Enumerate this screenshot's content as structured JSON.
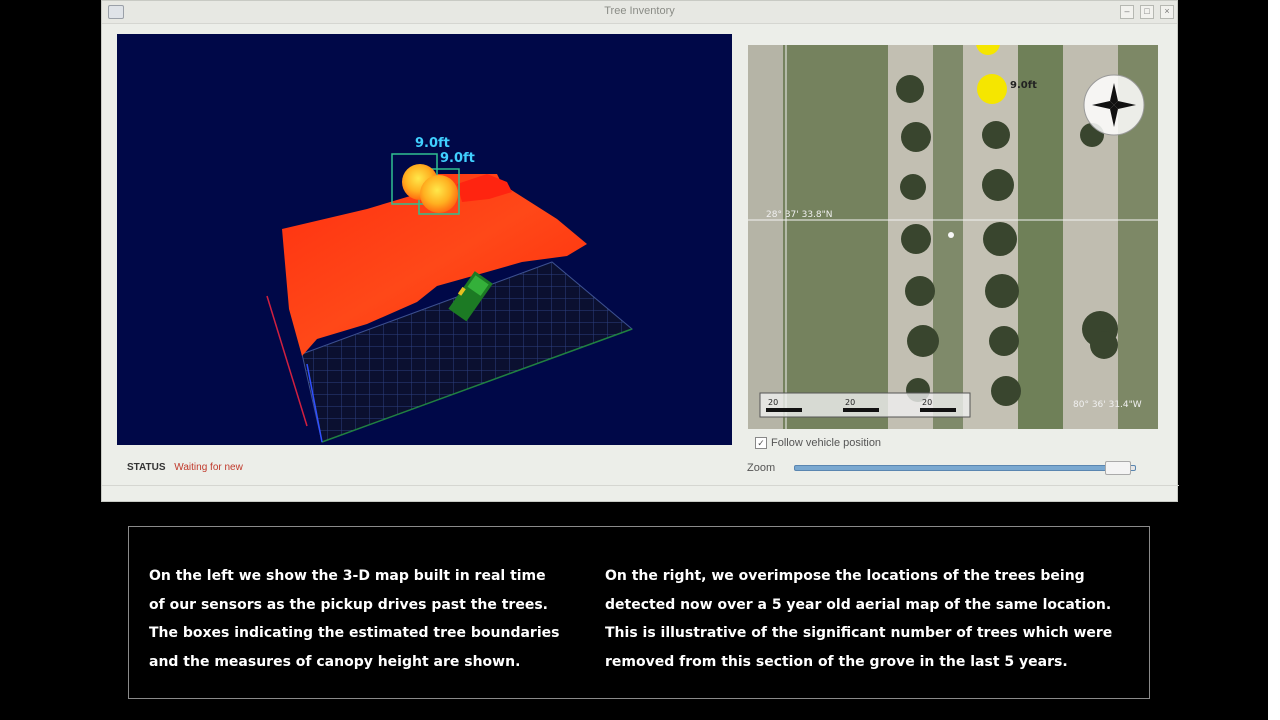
{
  "window": {
    "title": "Tree Inventory"
  },
  "viewer": {
    "labels": [
      "9.0ft",
      "9.0ft"
    ]
  },
  "status": {
    "label": "STATUS",
    "value": "Waiting for new"
  },
  "map": {
    "latitude_label": "28° 37' 33.8\"N",
    "longitude_label": "80° 36' 31.4\"W",
    "marker_label": "9.0ft",
    "compass_icon": "compass-rose-icon",
    "scale_labels": [
      "20",
      "20",
      "20"
    ]
  },
  "controls": {
    "follow_label": "Follow vehicle position",
    "follow_checked": true,
    "zoom_label": "Zoom",
    "zoom_level": 0.95
  },
  "caption": {
    "left_lines": [
      "On the left we show the 3-D map built in real time",
      "of our sensors as the pickup drives past the trees.",
      "The boxes indicating the estimated tree boundaries",
      "and the measures of canopy height are shown."
    ],
    "right_lines": [
      "On the right, we overimpose the locations of the trees being",
      "detected now over a 5 year old aerial map of the same location.",
      "This is illustrative of the significant number of trees which were",
      "removed from this section of the grove in the last 5 years."
    ]
  },
  "colors": {
    "viewer_bg": "#000848",
    "terrain": "#ff2a10",
    "status_red": "#c0392b",
    "map_marker": "#f5e600"
  }
}
